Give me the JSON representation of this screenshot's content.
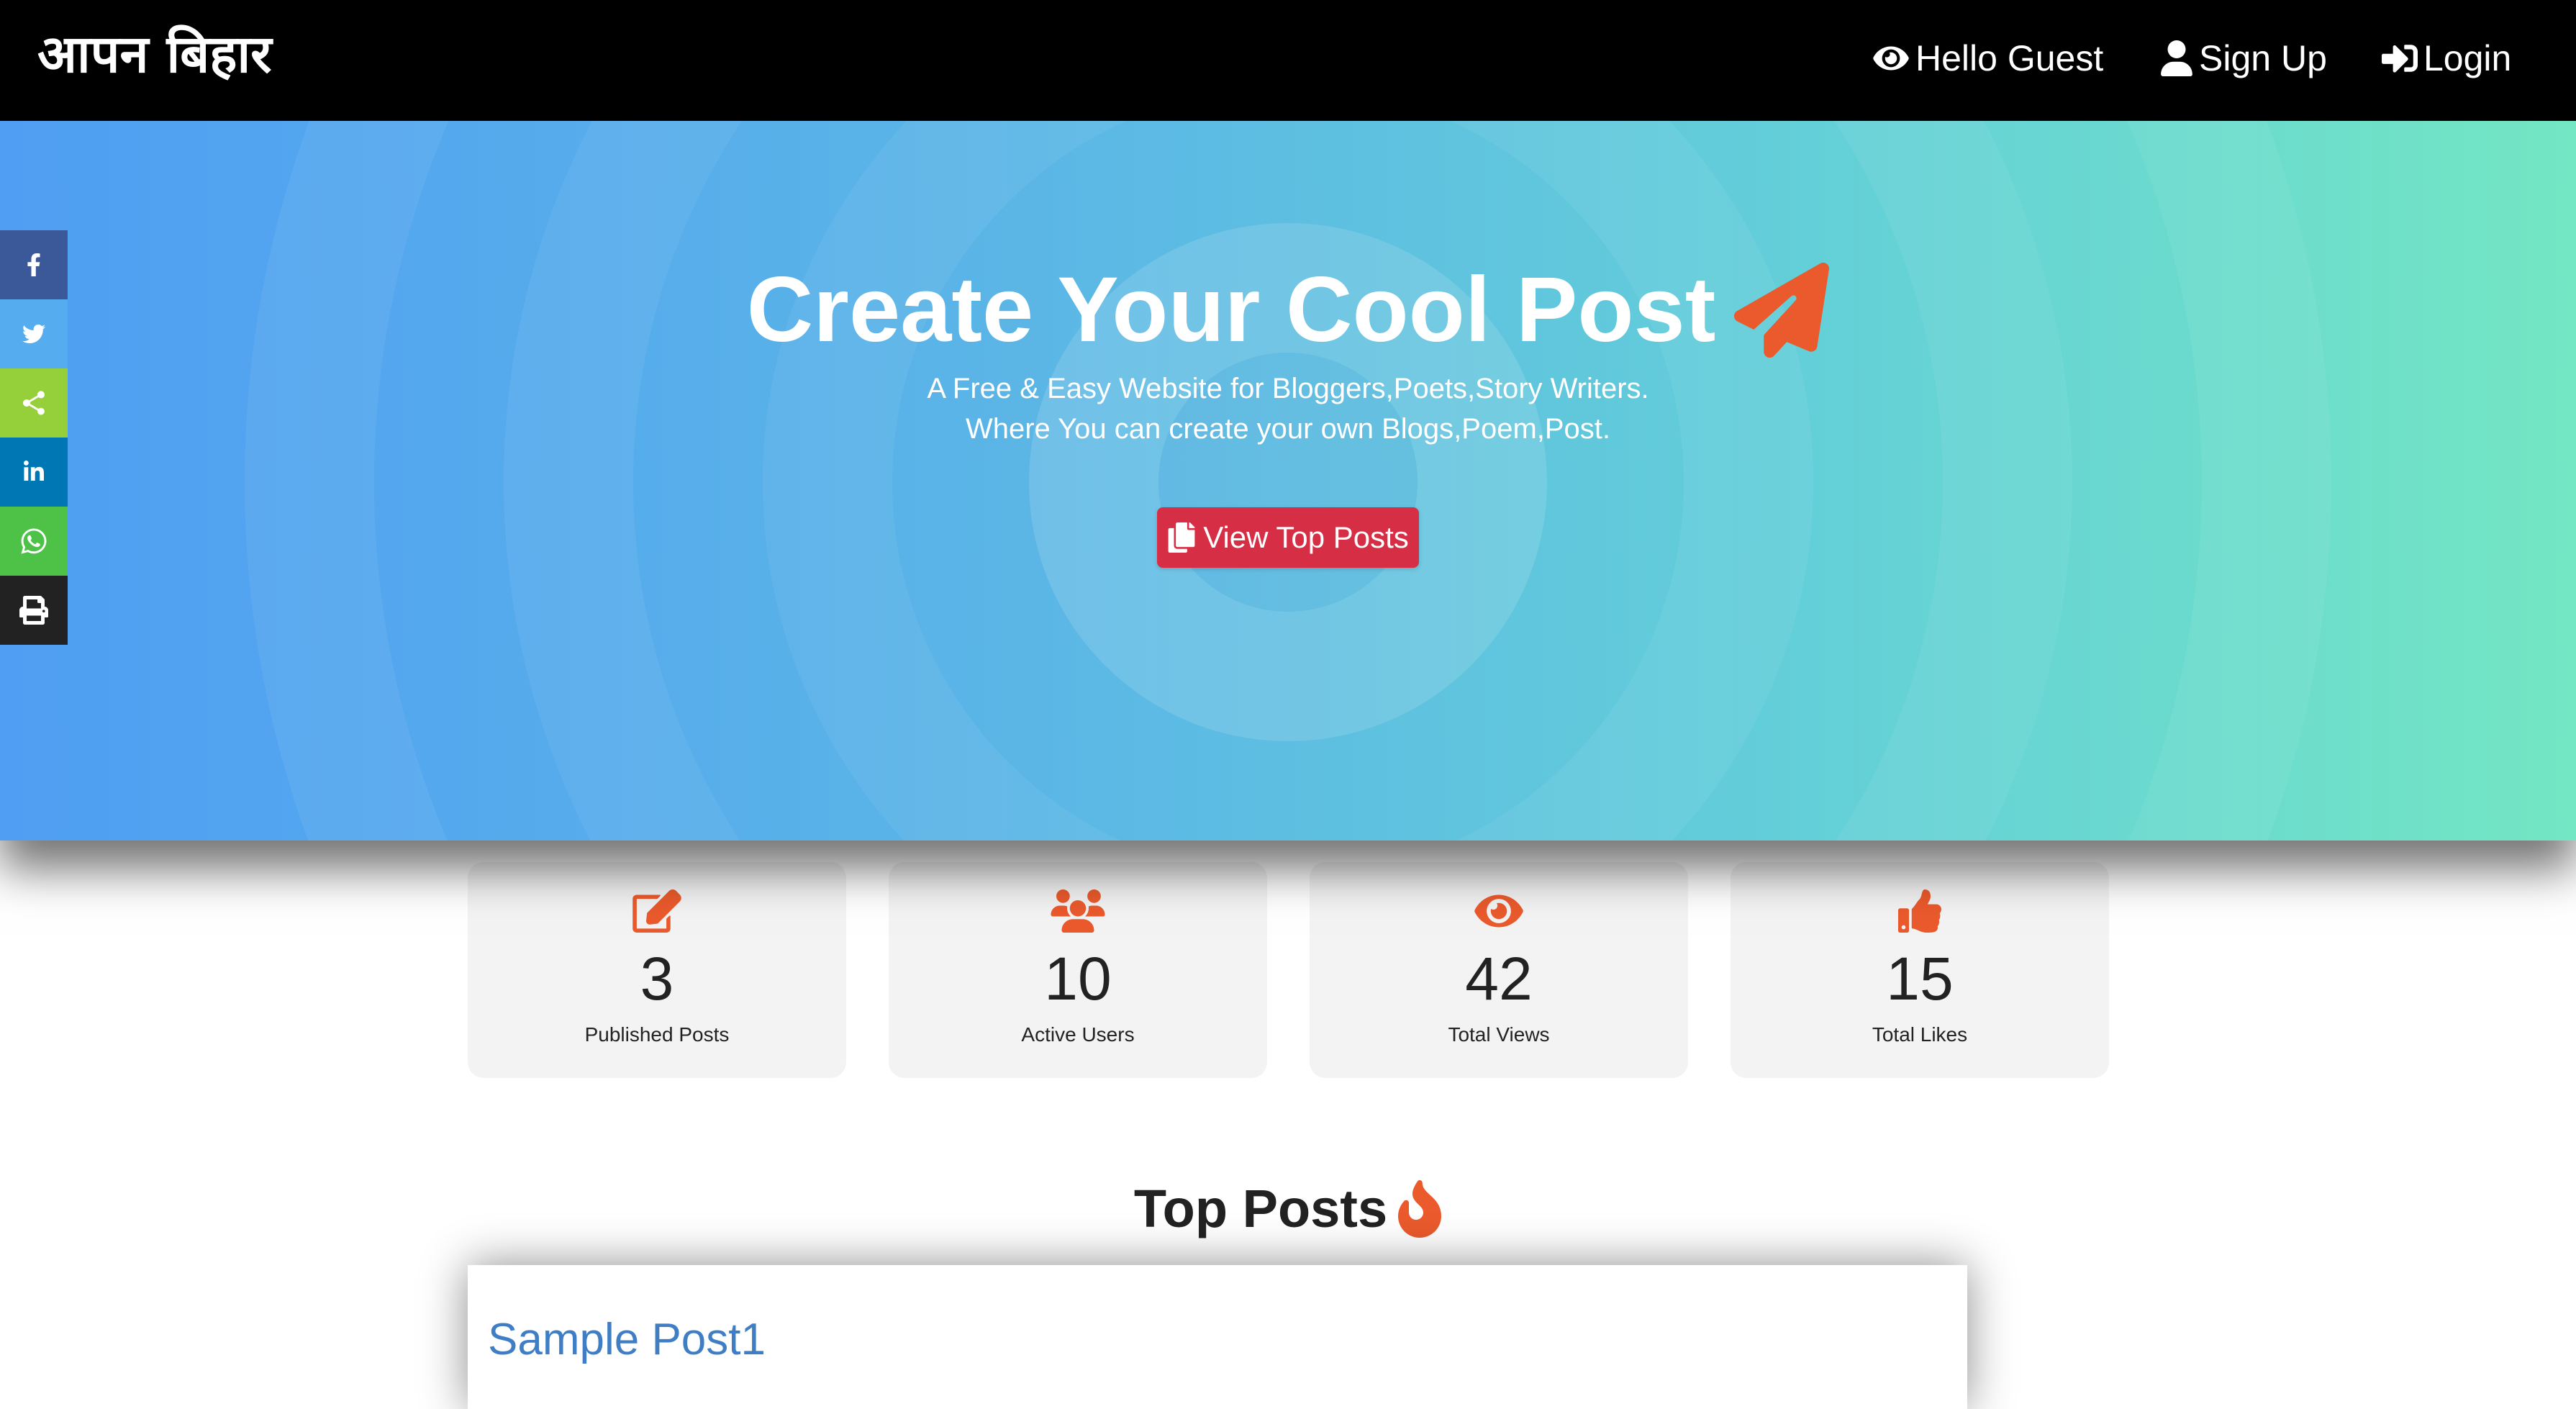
{
  "navbar": {
    "brand": "आपन बिहार",
    "items": [
      {
        "label": "Hello Guest",
        "icon": "eye-icon"
      },
      {
        "label": "Sign Up",
        "icon": "user-icon"
      },
      {
        "label": "Login",
        "icon": "sign-in-icon"
      }
    ]
  },
  "hero": {
    "title": "Create Your Cool Post",
    "title_icon": "paper-plane-icon",
    "subtitle_line1": "A Free & Easy Website for Bloggers,Poets,Story Writers.",
    "subtitle_line2": "Where You can create your own Blogs,Poem,Post.",
    "button_label": "View Top Posts",
    "button_icon": "copy-icon"
  },
  "social": [
    {
      "name": "facebook",
      "icon": "facebook-icon",
      "color": "#3b5998"
    },
    {
      "name": "twitter",
      "icon": "twitter-icon",
      "color": "#55acee"
    },
    {
      "name": "share",
      "icon": "share-icon",
      "color": "#95d03a"
    },
    {
      "name": "linkedin",
      "icon": "linkedin-icon",
      "color": "#0077b5"
    },
    {
      "name": "whatsapp",
      "icon": "whatsapp-icon",
      "color": "#4dc247"
    },
    {
      "name": "print",
      "icon": "print-icon",
      "color": "#222222"
    }
  ],
  "stats": [
    {
      "value": "3",
      "label": "Published Posts",
      "icon": "edit-icon"
    },
    {
      "value": "10",
      "label": "Active Users",
      "icon": "users-icon"
    },
    {
      "value": "42",
      "label": "Total Views",
      "icon": "eye-icon"
    },
    {
      "value": "15",
      "label": "Total Likes",
      "icon": "thumbs-up-icon"
    }
  ],
  "top_posts": {
    "title": "Top Posts",
    "title_icon": "fire-icon",
    "posts": [
      {
        "title": "Sample Post1"
      }
    ]
  },
  "colors": {
    "accent": "#ea5a2c",
    "button": "#d62f45",
    "link": "#3f7ec4",
    "hero_start": "#4f9ef3",
    "hero_end": "#73e6c3"
  }
}
